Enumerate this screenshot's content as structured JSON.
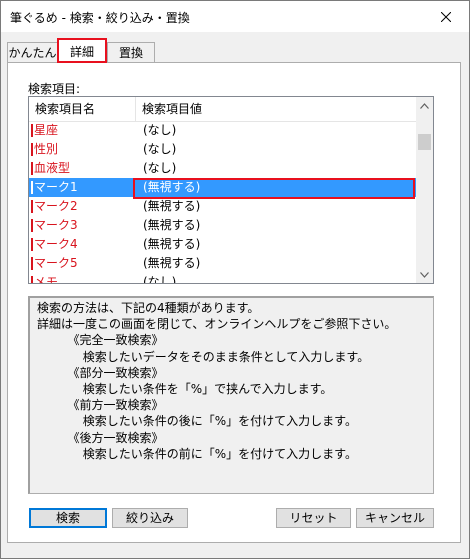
{
  "window": {
    "title": "筆ぐるめ - 検索・絞り込み・置換"
  },
  "tabs": [
    {
      "label": "かんたん"
    },
    {
      "label": "詳細",
      "selected": true
    },
    {
      "label": "置換"
    }
  ],
  "search_items": {
    "label": "検索項目:",
    "columns": {
      "name": "検索項目名",
      "value": "検索項目値"
    },
    "rows": [
      {
        "name": "星座",
        "value": "(なし)"
      },
      {
        "name": "性別",
        "value": "(なし)"
      },
      {
        "name": "血液型",
        "value": "(なし)"
      },
      {
        "name": "マーク1",
        "value": "(無視する)",
        "selected": true
      },
      {
        "name": "マーク2",
        "value": "(無視する)"
      },
      {
        "name": "マーク3",
        "value": "(無視する)"
      },
      {
        "name": "マーク4",
        "value": "(無視する)"
      },
      {
        "name": "マーク5",
        "value": "(無視する)"
      },
      {
        "name": "メモ",
        "value": "(なし)"
      }
    ]
  },
  "help_text": [
    "検索の方法は、下記の4種類があります。",
    "詳細は一度この画面を閉じて、オンラインヘルプをご参照下さい。",
    "        《完全一致検索》",
    "            検索したいデータをそのまま条件として入力します。",
    "        《部分一致検索》",
    "            検索したい条件を「%」で挟んで入力します。",
    "        《前方一致検索》",
    "            検索したい条件の後に「%」を付けて入力します。",
    "        《後方一致検索》",
    "            検索したい条件の前に「%」を付けて入力します。"
  ],
  "buttons": {
    "search": "検索",
    "filter": "絞り込み",
    "reset": "リセット",
    "cancel": "キャンセル"
  },
  "colors": {
    "accent": "#0078d7",
    "selection": "#3399ff",
    "item_name_red": "#d8141e",
    "highlight_red": "#e8101e"
  }
}
